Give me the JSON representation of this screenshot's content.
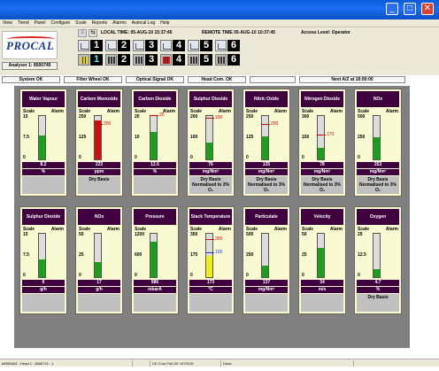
{
  "window": {
    "minimize": "_",
    "maximize": "□",
    "close": "✕"
  },
  "menu": [
    "View",
    "Trend",
    "Panel",
    "Configure",
    "Scale",
    "Reports",
    "Alarms",
    "Autocal Log",
    "Help"
  ],
  "toolbar": {
    "logo": "PROCAL",
    "analyser": "Analyser 1: 8500745",
    "local_time": "LOCAL TIME: 05-AUG-10 15:37:45",
    "remote_time": "REMOTE TIME 05-AUG-10 10:37:45",
    "access_level": "Access Level: Operator",
    "analyser_buttons": [
      {
        "num": "1",
        "style": "line"
      },
      {
        "num": "2",
        "style": "line"
      },
      {
        "num": "3",
        "style": "line"
      },
      {
        "num": "4",
        "style": "line"
      },
      {
        "num": "5",
        "style": "line"
      },
      {
        "num": "6",
        "style": "line"
      },
      {
        "num": "1",
        "style": "bar-yellow"
      },
      {
        "num": "2",
        "style": "bar"
      },
      {
        "num": "3",
        "style": "bar"
      },
      {
        "num": "4",
        "style": "bar-red"
      },
      {
        "num": "5",
        "style": "bar"
      },
      {
        "num": "6",
        "style": "bar"
      }
    ]
  },
  "status": {
    "system": "System OK",
    "filter": "Filter Wheel OK",
    "optical": "Optical Signal OK",
    "head": "Head Com. OK",
    "blank": "",
    "next": "Next A/Z at 18:00:00"
  },
  "colors": {
    "gauge_title_bg": "#400040",
    "fill_green": "#1aa01a",
    "fill_red": "#d01010",
    "fill_yellow": "#f0f010",
    "alarm_red": "#d00000",
    "alarm_blue": "#2030e0"
  },
  "gauges": [
    {
      "title": "Water Vapour",
      "scale_label": "Scale",
      "alarm_label": "Alarm",
      "ticks": [
        "15",
        "7.5",
        "0"
      ],
      "level": 0.55,
      "fill": "green",
      "alarm": null,
      "value": "8.2",
      "unit": "%",
      "note": ""
    },
    {
      "title": "Carbon Monoxide",
      "scale_label": "Scale",
      "alarm_label": "Alarm",
      "ticks": [
        "250",
        "125",
        "0"
      ],
      "level": 0.89,
      "fill": "red",
      "alarm": {
        "label": "200",
        "frac": 0.8,
        "color": "red"
      },
      "value": "223",
      "unit": "ppm",
      "note": "Dry Basis"
    },
    {
      "title": "Carbon Dioxide",
      "scale_label": "Scale",
      "alarm_label": "Alarm",
      "ticks": [
        "20",
        "10",
        "0"
      ],
      "level": 0.63,
      "fill": "green",
      "alarm": {
        "label": "20",
        "frac": 1.0,
        "color": "red"
      },
      "value": "12.6",
      "unit": "%",
      "note": ""
    },
    {
      "title": "Sulphur Dioxide",
      "scale_label": "Scale",
      "alarm_label": "Alarm",
      "ticks": [
        "200",
        "100",
        "0"
      ],
      "level": 0.38,
      "fill": "green",
      "alarm": {
        "label": "190",
        "frac": 0.95,
        "color": "red"
      },
      "value": "76",
      "unit": "mg/Nm³",
      "note": "Dry Basis Normalised to 3% O₂"
    },
    {
      "title": "Nitric Oxide",
      "scale_label": "Scale",
      "alarm_label": "Alarm",
      "ticks": [
        "250",
        "125",
        "0"
      ],
      "level": 0.54,
      "fill": "green",
      "alarm": {
        "label": "200",
        "frac": 0.8,
        "color": "red"
      },
      "value": "135",
      "unit": "mg/Nm³",
      "note": "Dry Basis Normalised to 3% O₂"
    },
    {
      "title": "Nitrogen Dioxide",
      "scale_label": "Scale",
      "alarm_label": "Alarm",
      "ticks": [
        "300",
        "150",
        "0"
      ],
      "level": 0.26,
      "fill": "green",
      "alarm": {
        "label": "170",
        "frac": 0.57,
        "color": "red"
      },
      "value": "78",
      "unit": "mg/Nm³",
      "note": "Dry Basis Normalised to 3% O₂"
    },
    {
      "title": "NOx",
      "scale_label": "Scale",
      "alarm_label": "Alarm",
      "ticks": [
        "500",
        "250",
        "0"
      ],
      "level": 0.51,
      "fill": "green",
      "alarm": null,
      "value": "253",
      "unit": "mg/Nm³",
      "note": "Dry Basis Normalised to 3% O₂"
    },
    {
      "title": "Sulphur Dioxide",
      "scale_label": "Scale",
      "alarm_label": "Alarm",
      "ticks": [
        "15",
        "7.5",
        "0"
      ],
      "level": 0.4,
      "fill": "green",
      "alarm": null,
      "value": "6",
      "unit": "g/h",
      "note": ""
    },
    {
      "title": "NOx",
      "scale_label": "Scale",
      "alarm_label": "Alarm",
      "ticks": [
        "50",
        "25",
        "0"
      ],
      "level": 0.34,
      "fill": "green",
      "alarm": null,
      "value": "17",
      "unit": "g/h",
      "note": ""
    },
    {
      "title": "Pressure",
      "scale_label": "Scale",
      "alarm_label": "",
      "ticks": [
        "1200",
        "600",
        "0"
      ],
      "level": 0.82,
      "fill": "green",
      "alarm": null,
      "value": "986",
      "unit": "mbarA",
      "note": ""
    },
    {
      "title": "Stack Temperature",
      "scale_label": "Scale",
      "alarm_label": "Alarm",
      "ticks": [
        "350",
        "175",
        "0"
      ],
      "level": 0.49,
      "fill": "yellow",
      "alarm": {
        "label": "300",
        "frac": 0.86,
        "color": "red"
      },
      "alarm2": {
        "label": "100",
        "frac": 0.57,
        "color": "blue"
      },
      "value": "173",
      "unit": "°C",
      "note": ""
    },
    {
      "title": "Particulate",
      "scale_label": "Scale",
      "alarm_label": "Alarm",
      "ticks": [
        "500",
        "250",
        "0"
      ],
      "level": 0.27,
      "fill": "green",
      "alarm": null,
      "value": "137",
      "unit": "mg/Nm³",
      "note": ""
    },
    {
      "title": "Velocity",
      "scale_label": "Scale",
      "alarm_label": "Alarm",
      "ticks": [
        "50",
        "25",
        "0"
      ],
      "level": 0.68,
      "fill": "green",
      "alarm": null,
      "value": "34",
      "unit": "m/s",
      "note": ""
    },
    {
      "title": "Oxygen",
      "scale_label": "Scale",
      "alarm_label": "Alarm",
      "ticks": [
        "25",
        "12.5",
        "0"
      ],
      "level": 0.19,
      "fill": "green",
      "alarm": null,
      "value": "4.7",
      "unit": "%",
      "note": "Dry Basis"
    }
  ],
  "bottom_status": [
    "b8500481 : Head 1 : 8500741 : 1",
    "",
    "CE Com Poll OK 1970125",
    "Done."
  ]
}
